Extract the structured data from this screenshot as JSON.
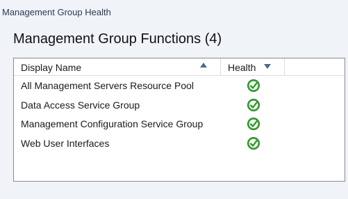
{
  "page": {
    "header": "Management Group Health"
  },
  "section": {
    "title": "Management Group Functions (4)"
  },
  "table": {
    "columns": [
      {
        "label": "Display Name",
        "sort": "ascending"
      },
      {
        "label": "Health",
        "sort": "descending"
      }
    ],
    "rows": [
      {
        "display_name": "All Management Servers Resource Pool",
        "health": "check-icon"
      },
      {
        "display_name": "Data Access Service Group",
        "health": "check-icon"
      },
      {
        "display_name": "Management Configuration Service Group",
        "health": "check-icon"
      },
      {
        "display_name": "Web User Interfaces",
        "health": "check-icon"
      }
    ]
  },
  "colors": {
    "healthy_green": "#3aa832",
    "sort_arrow": "#4a6a8c"
  }
}
